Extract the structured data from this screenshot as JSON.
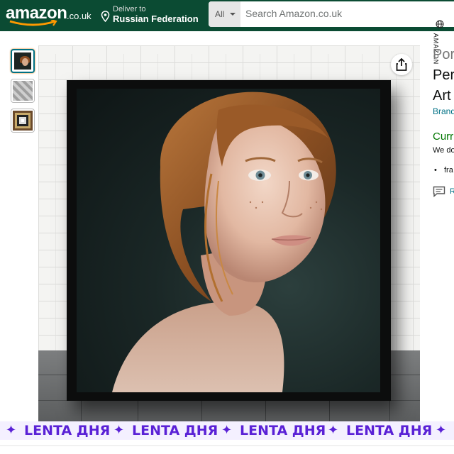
{
  "header": {
    "logo_text": "amazon",
    "logo_tld": ".co.uk",
    "deliver_label": "Deliver to",
    "deliver_location": "Russian Federation",
    "search_category": "All",
    "search_placeholder": "Search Amazon.co.uk"
  },
  "thumbnails": [
    {
      "name": "thumbnail-portrait",
      "selected": true
    },
    {
      "name": "thumbnail-room",
      "selected": false
    },
    {
      "name": "thumbnail-frames",
      "selected": false
    }
  ],
  "side_tag": "AMAZON",
  "product": {
    "title_line1": "Por",
    "title_line2": "Per",
    "title_line3": "Art",
    "brand": "Brand",
    "availability": "Curr",
    "availability_note": "We do",
    "bullet": "fra",
    "report": "R"
  },
  "banner": {
    "text": "LENTA ДНЯ",
    "separator": "✦",
    "color": "#5a21d6"
  },
  "colors": {
    "header_bg": "#0b4b33",
    "link": "#007185",
    "availability": "#007600"
  }
}
